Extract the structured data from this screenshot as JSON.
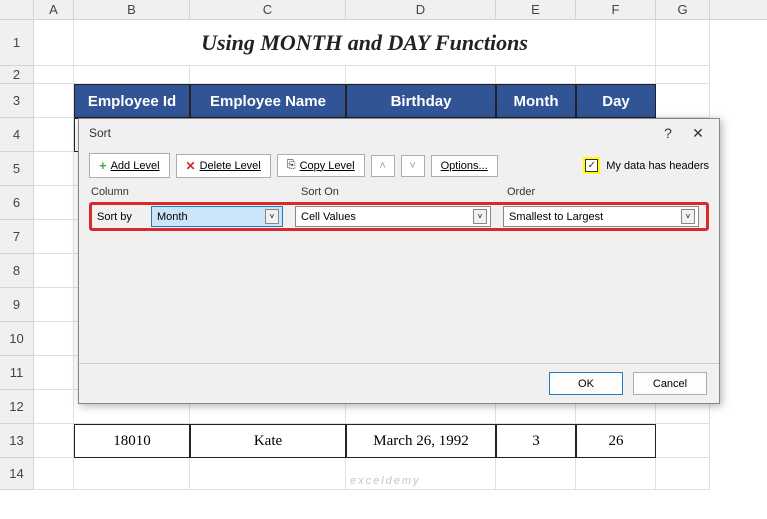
{
  "columns": [
    "A",
    "B",
    "C",
    "D",
    "E",
    "F",
    "G"
  ],
  "rows": [
    "1",
    "2",
    "3",
    "4",
    "5",
    "6",
    "7",
    "8",
    "9",
    "10",
    "11",
    "12",
    "13",
    "14"
  ],
  "title": "Using MONTH and DAY Functions",
  "headers": {
    "empId": "Employee Id",
    "empName": "Employee Name",
    "birthday": "Birthday",
    "month": "Month",
    "day": "Day"
  },
  "dataRow": {
    "empId": "18010",
    "empName": "Kate",
    "birthday": "March 26, 1992",
    "month": "3",
    "day": "26"
  },
  "dialog": {
    "title": "Sort",
    "addLevel": "Add Level",
    "deleteLevel": "Delete Level",
    "copyLevel": "Copy Level",
    "options": "Options...",
    "headersLabel": "My data has headers",
    "colHeader": "Column",
    "sortOnHeader": "Sort On",
    "orderHeader": "Order",
    "sortByLabel": "Sort by",
    "sortByValue": "Month",
    "sortOnValue": "Cell Values",
    "orderValue": "Smallest to Largest",
    "ok": "OK",
    "cancel": "Cancel",
    "help": "?",
    "close": "✕"
  },
  "watermark": "exceldemy"
}
